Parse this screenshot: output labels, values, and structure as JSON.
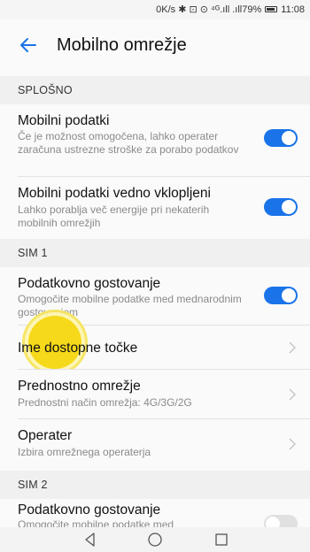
{
  "status_bar": {
    "text": "0K/s ✱ ⊡ ⊙ ⁴ᴳ.ıll .ıll79%",
    "time": "11:08"
  },
  "header": {
    "title": "Mobilno omrežje"
  },
  "sections": {
    "general": "SPLOŠNO",
    "sim1": "SIM 1",
    "sim2": "SIM 2"
  },
  "items": {
    "mobile_data": {
      "title": "Mobilni podatki",
      "subtitle": "Če je možnost omogočena, lahko operater zaračuna ustrezne stroške za porabo podatkov",
      "enabled": true
    },
    "always_on": {
      "title": "Mobilni podatki vedno vklopljeni",
      "subtitle": "Lahko porablja več energije pri nekaterih mobilnih omrežjih",
      "enabled": true
    },
    "sim1_roaming": {
      "title": "Podatkovno gostovanje",
      "subtitle": "Omogočite mobilne podatke med mednarodnim gostovanjem",
      "enabled": true
    },
    "apn": {
      "title": "Ime dostopne točke"
    },
    "preferred": {
      "title": "Prednostno omrežje",
      "subtitle": "Prednostni način omrežja: 4G/3G/2G"
    },
    "operator": {
      "title": "Operater",
      "subtitle": "Izbira omrežnega operaterja"
    },
    "sim2_roaming": {
      "title": "Podatkovno gostovanje",
      "subtitle": "Omogočite mobilne podatke med",
      "enabled": false
    }
  },
  "icons": {
    "back": "arrow-left-icon",
    "chevron": "chevron-right-icon",
    "nav_back": "triangle-back-icon",
    "nav_home": "circle-home-icon",
    "nav_recent": "square-recent-icon"
  },
  "colors": {
    "accent": "#1a73e8",
    "touch": "#f6d80f"
  }
}
